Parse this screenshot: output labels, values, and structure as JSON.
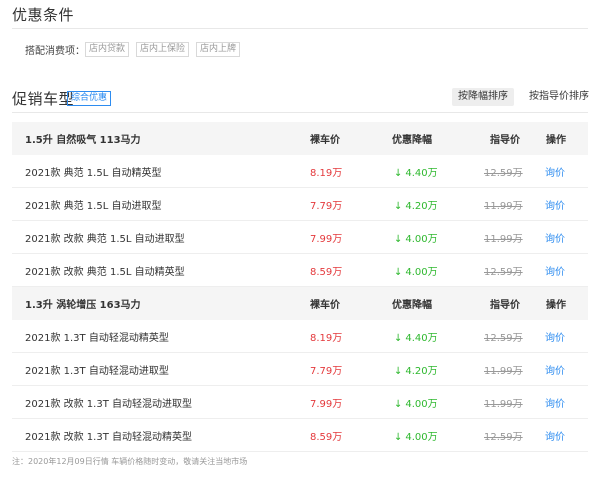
{
  "conditions": {
    "title": "优惠条件",
    "label": "搭配消费项：",
    "tags": [
      "店内贷款",
      "店内上保险",
      "店内上牌"
    ]
  },
  "promo": {
    "title": "促销车型",
    "badge": "综合优惠",
    "sort_active": "按降幅排序",
    "sort_guide": "按指导价排序"
  },
  "table": {
    "headers": {
      "price": "裸车价",
      "drop": "优惠降幅",
      "guide": "指导价",
      "op": "操作"
    },
    "groups": [
      {
        "name": "1.5升 自然吸气 113马力",
        "rows": [
          {
            "name": "2021款 典范 1.5L 自动精英型",
            "price": "8.19万",
            "drop": "4.40万",
            "guide": "12.59万",
            "op": "询价"
          },
          {
            "name": "2021款 典范 1.5L 自动进取型",
            "price": "7.79万",
            "drop": "4.20万",
            "guide": "11.99万",
            "op": "询价"
          },
          {
            "name": "2021款 改款 典范 1.5L 自动进取型",
            "price": "7.99万",
            "drop": "4.00万",
            "guide": "11.99万",
            "op": "询价"
          },
          {
            "name": "2021款 改款 典范 1.5L 自动精英型",
            "price": "8.59万",
            "drop": "4.00万",
            "guide": "12.59万",
            "op": "询价"
          }
        ]
      },
      {
        "name": "1.3升 涡轮增压 163马力",
        "rows": [
          {
            "name": "2021款 1.3T 自动轻混动精英型",
            "price": "8.19万",
            "drop": "4.40万",
            "guide": "12.59万",
            "op": "询价"
          },
          {
            "name": "2021款 1.3T 自动轻混动进取型",
            "price": "7.79万",
            "drop": "4.20万",
            "guide": "11.99万",
            "op": "询价"
          },
          {
            "name": "2021款 改款 1.3T 自动轻混动进取型",
            "price": "7.99万",
            "drop": "4.00万",
            "guide": "11.99万",
            "op": "询价"
          },
          {
            "name": "2021款 改款 1.3T 自动轻混动精英型",
            "price": "8.59万",
            "drop": "4.00万",
            "guide": "12.59万",
            "op": "询价"
          }
        ]
      }
    ]
  },
  "note": "注：2020年12月09日行情 车辆价格随时变动，敬请关注当地市场",
  "icons": {
    "drop_arrow": "down-arrow-icon"
  },
  "colors": {
    "price": "#e4393c",
    "drop": "#2eb82e",
    "link": "#2d8cf0"
  }
}
